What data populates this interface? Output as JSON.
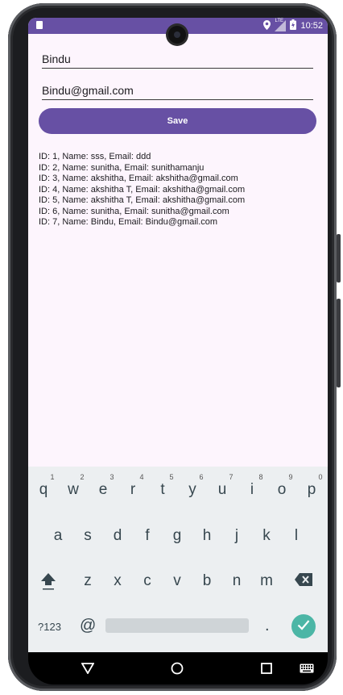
{
  "status_bar": {
    "time": "10:52",
    "network_label": "LTE"
  },
  "form": {
    "name_value": "Bindu",
    "email_value": "Bindu@gmail.com",
    "save_label": "Save"
  },
  "records": [
    "ID: 1, Name: sss, Email: ddd",
    "ID: 2, Name: sunitha, Email: sunithamanju",
    "ID: 3, Name: akshitha, Email: akshitha@gmail.com",
    "ID: 4, Name: akshitha T, Email: akshitha@gmail.com",
    "ID: 5, Name: akshitha T, Email: akshitha@gmail.com",
    "ID: 6, Name: sunitha, Email: sunitha@gmail.com",
    "ID: 7, Name: Bindu, Email: Bindu@gmail.com"
  ],
  "keyboard": {
    "row1": [
      "q",
      "w",
      "e",
      "r",
      "t",
      "y",
      "u",
      "i",
      "o",
      "p"
    ],
    "row1_hints": [
      "1",
      "2",
      "3",
      "4",
      "5",
      "6",
      "7",
      "8",
      "9",
      "0"
    ],
    "row2": [
      "a",
      "s",
      "d",
      "f",
      "g",
      "h",
      "j",
      "k",
      "l"
    ],
    "row3": [
      "z",
      "x",
      "c",
      "v",
      "b",
      "n",
      "m"
    ],
    "symbols_label": "?123",
    "at_label": "@",
    "period_label": ".",
    "icons": {
      "shift": "shift-icon",
      "backspace": "backspace-icon",
      "enter": "check-icon"
    }
  },
  "nav": {
    "icons": [
      "back-icon",
      "home-icon",
      "recents-icon",
      "keyboard-switch-icon"
    ]
  },
  "colors": {
    "primary": "#6750a4",
    "background": "#fdf5fd",
    "keyboard": "#eceff1",
    "enter": "#4cb6a6"
  }
}
